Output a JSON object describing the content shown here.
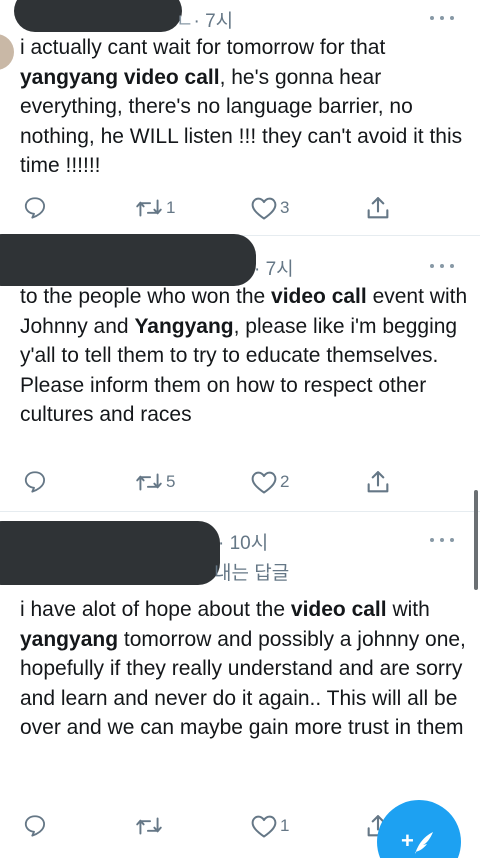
{
  "tweets": [
    {
      "time": "· 7시",
      "time_fragment": "ㄴ",
      "body": [
        {
          "t": "i actually cant wait for tomorrow for that "
        },
        {
          "t": "yangyang video call",
          "b": true
        },
        {
          "t": ", he's gonna hear everything, there's no language barrier, no nothing, he WILL listen !!! they can't avoid it this time !!!!!!"
        }
      ],
      "replies": "",
      "retweets": "1",
      "likes": "3"
    },
    {
      "time": "· 7시",
      "body": [
        {
          "t": "to the people who won the "
        },
        {
          "t": "video call",
          "b": true
        },
        {
          "t": " event with Johnny and "
        },
        {
          "t": "Yangyang",
          "b": true
        },
        {
          "t": ", please like i'm begging y'all to tell them to try to educate themselves. Please inform them on how to respect other cultures and races"
        }
      ],
      "replies": "",
      "retweets": "5",
      "likes": "2"
    },
    {
      "time": "· 10시",
      "reply_fragment": "내는 답글",
      "body": [
        {
          "t": "i have alot of hope about the "
        },
        {
          "t": "video call",
          "b": true
        },
        {
          "t": " with "
        },
        {
          "t": "yangyang",
          "b": true
        },
        {
          "t": " tomorrow and possibly a johnny one, hopefully if they really understand and are sorry and learn and never do it again.. This will all be over and we can maybe gain more trust in them"
        }
      ],
      "replies": "",
      "retweets": "",
      "likes": "1"
    }
  ],
  "fab_label": "+",
  "colors": {
    "accent": "#1da1f2",
    "icon": "#657786",
    "text": "#14171a",
    "redaction": "#2f3336"
  },
  "icons": {
    "reply": "reply-icon",
    "retweet": "retweet-icon",
    "like": "heart-icon",
    "share": "share-icon",
    "more": "more-dots-icon",
    "compose": "compose-feather-icon"
  }
}
